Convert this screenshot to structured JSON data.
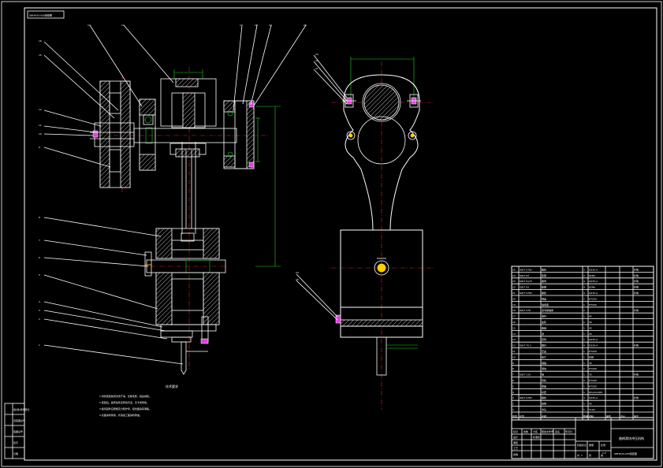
{
  "sheet": {
    "border_color": "#ffffff",
    "background": "#000000",
    "accent_red": "#e02020",
    "accent_green": "#20d020",
    "accent_magenta": "#e040e0",
    "accent_yellow": "#ffd000"
  },
  "balloons_left": [
    "16",
    "15",
    "12",
    "11",
    "10",
    "9",
    "8",
    "7",
    "6",
    "5",
    "4",
    "3",
    "2",
    "1"
  ],
  "balloons_top": [
    "13",
    "14",
    "17",
    "18",
    "19",
    "20"
  ],
  "balloons_right": [
    "23",
    "22",
    "21",
    "24",
    "25"
  ],
  "tech_requirements": {
    "title": "技术要求",
    "lines": [
      "1.零件装配前须清洗干净，去除毛刺，锐边倒钝。",
      "2.装配后，各转动件应转动灵活，无卡滞现象。",
      "3.各紧固件应按规定力矩拧紧，配合面涂润滑脂。",
      "4.表面涂防锈漆，外露加工面涂防锈油。"
    ]
  },
  "bom": {
    "headers": [
      "序号",
      "代号",
      "名称",
      "数量",
      "材料",
      "单件",
      "总计",
      "备注"
    ],
    "rows": [
      [
        "25",
        "GB/T 5783",
        "螺栓",
        "2",
        "Q235-A",
        "",
        "",
        "外购"
      ],
      [
        "24",
        "GB/T 93",
        "垫圈",
        "2",
        "65Mn",
        "",
        "",
        "外购"
      ],
      [
        "23",
        "GB/T 6170",
        "螺母",
        "4",
        "Q235-A",
        "",
        "",
        "外购"
      ],
      [
        "22",
        "GB/T 93",
        "垫圈",
        "4",
        "65Mn",
        "",
        "",
        "外购"
      ],
      [
        "21",
        "GB/T 5783",
        "螺栓",
        "4",
        "Q235-A",
        "",
        "",
        "外购"
      ],
      [
        "20",
        "",
        "端盖",
        "1",
        "HT200",
        "",
        "",
        ""
      ],
      [
        "19",
        "",
        "轴承座",
        "1",
        "HT200",
        "",
        "",
        ""
      ],
      [
        "18",
        "GB/T 276",
        "深沟球轴承",
        "2",
        "",
        "",
        "",
        "外购"
      ],
      [
        "17",
        "",
        "连杆",
        "1",
        "45",
        "",
        "",
        ""
      ],
      [
        "16",
        "",
        "齿轮",
        "1",
        "45",
        "",
        "",
        ""
      ],
      [
        "15",
        "",
        "曲轴",
        "1",
        "45",
        "",
        "",
        ""
      ],
      [
        "14",
        "",
        "键",
        "1",
        "45",
        "",
        "",
        ""
      ],
      [
        "13",
        "",
        "套筒",
        "1",
        "Q235-A",
        "",
        "",
        ""
      ],
      [
        "12",
        "GB/T 70.1",
        "螺钉",
        "4",
        "Q235-A",
        "",
        "",
        "外购"
      ],
      [
        "11",
        "",
        "压盖",
        "1",
        "HT200",
        "",
        "",
        ""
      ],
      [
        "10",
        "",
        "垫片",
        "1",
        "石棉",
        "",
        "",
        ""
      ],
      [
        "9",
        "",
        "销轴",
        "1",
        "45",
        "",
        "",
        ""
      ],
      [
        "8",
        "",
        "滑块",
        "1",
        "HT200",
        "",
        "",
        ""
      ],
      [
        "7",
        "GB/T 119",
        "销",
        "1",
        "35",
        "",
        "",
        "外购"
      ],
      [
        "6",
        "",
        "导轨",
        "2",
        "HT200",
        "",
        "",
        ""
      ],
      [
        "5",
        "",
        "底座",
        "1",
        "HT200",
        "",
        "",
        ""
      ],
      [
        "4",
        "",
        "衬套",
        "1",
        "ZCuSn10P1",
        "",
        "",
        ""
      ],
      [
        "3",
        "GB/T 5783",
        "螺栓",
        "4",
        "Q235-A",
        "",
        "",
        "外购"
      ],
      [
        "2",
        "",
        "模柄",
        "1",
        "45",
        "",
        "",
        ""
      ],
      [
        "1",
        "",
        "冲头",
        "1",
        "T10A",
        "",
        "",
        ""
      ]
    ]
  },
  "title_block": {
    "title": "曲柄滑块冲压机构",
    "drawing_no": "QBHK-00-000装配图",
    "labels": [
      "标记",
      "处数",
      "分区",
      "更改文件号",
      "签名",
      "年月日",
      "设计",
      "标准化",
      "审核",
      "工艺",
      "批准",
      "阶段标记",
      "重量",
      "比例",
      "共",
      "张",
      "第"
    ],
    "scale": "1:2",
    "sheets": "1"
  },
  "left_strip": [
    "借(通)用件登记",
    "旧底图总号",
    "底图总号",
    "签字",
    "日期"
  ],
  "stamp_top_left": "QBHK-00-000装配图"
}
